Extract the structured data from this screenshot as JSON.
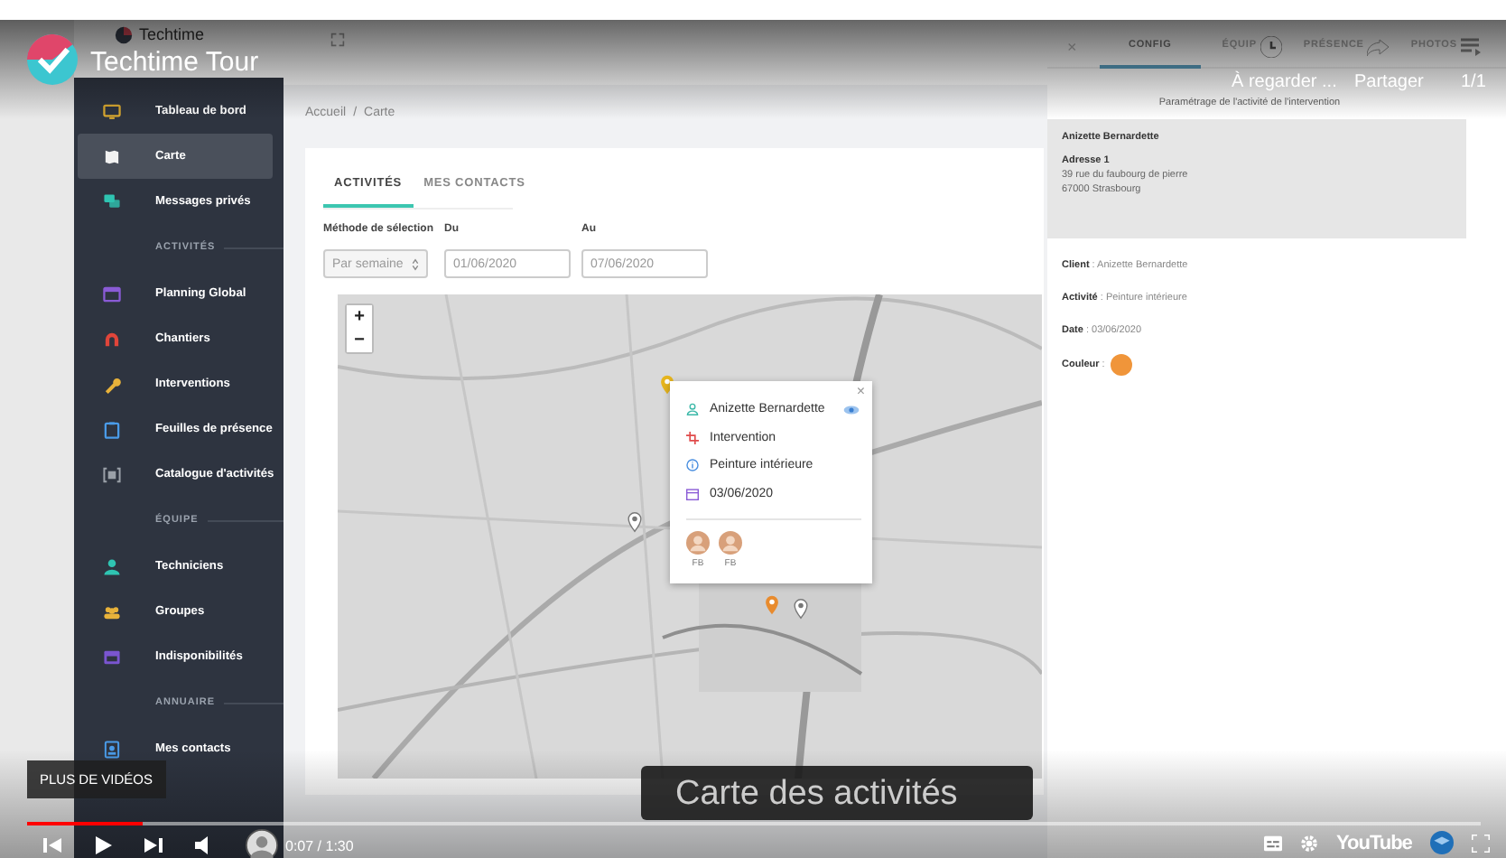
{
  "video": {
    "channel_title": "Techtime Tour",
    "watch_later": "À regarder ...",
    "share": "Partager",
    "playlist_position": "1/1",
    "more_videos": "PLUS DE VIDÉOS",
    "time": "0:07 / 1:30",
    "caption": "Carte des activités",
    "brand": "YouTube",
    "progress": {
      "level": 0.08
    }
  },
  "app": {
    "logo_text": "Techtime",
    "sidebar": [
      {
        "kind": "link",
        "label": "Tableau de bord",
        "selected": false,
        "color": "#d9a830"
      },
      {
        "kind": "link",
        "label": "Carte",
        "selected": true,
        "color": "#f2f2f2"
      },
      {
        "kind": "link",
        "label": "Messages privés",
        "selected": false,
        "color": "#2fc4b2"
      },
      {
        "kind": "section",
        "label": "ACTIVITÉS"
      },
      {
        "kind": "link",
        "label": "Planning Global",
        "selected": false,
        "color": "#8a5bd6"
      },
      {
        "kind": "link",
        "label": "Chantiers",
        "selected": false,
        "color": "#e0453a"
      },
      {
        "kind": "link",
        "label": "Interventions",
        "selected": false,
        "color": "#e8b23a"
      },
      {
        "kind": "link",
        "label": "Feuilles de présence",
        "selected": false,
        "color": "#4a9be8"
      },
      {
        "kind": "link",
        "label": "Catalogue d'activités",
        "selected": false,
        "color": "#9aa0a8"
      },
      {
        "kind": "section",
        "label": "ÉQUIPE"
      },
      {
        "kind": "link",
        "label": "Techniciens",
        "selected": false,
        "color": "#2fc4b2"
      },
      {
        "kind": "link",
        "label": "Groupes",
        "selected": false,
        "color": "#e8b23a"
      },
      {
        "kind": "link",
        "label": "Indisponibilités",
        "selected": false,
        "color": "#7a55d0"
      },
      {
        "kind": "section",
        "label": "ANNUAIRE"
      },
      {
        "kind": "link",
        "label": "Mes contacts",
        "selected": false,
        "color": "#4a9be8"
      }
    ],
    "breadcrumb": {
      "items": [
        "Accueil",
        "Carte"
      ],
      "separator": "/"
    },
    "tabs": [
      {
        "label": "ACTIVITÉS",
        "selected": true
      },
      {
        "label": "MES CONTACTS",
        "selected": false
      }
    ],
    "filters": {
      "method": {
        "label": "Méthode de sélection",
        "value": "Par semaine"
      },
      "from": {
        "label": "Du",
        "value": "01/06/2020"
      },
      "to": {
        "label": "Au",
        "value": "07/06/2020"
      }
    },
    "map": {
      "zoom_in": "+",
      "zoom_out": "−",
      "popup": {
        "close": "×",
        "name": "Anizette Bernardette",
        "type": "Intervention",
        "activity": "Peinture intérieure",
        "date": "03/06/2020",
        "avatars": [
          {
            "initials": "FB"
          },
          {
            "initials": "FB"
          }
        ]
      }
    },
    "details": {
      "close": "×",
      "tabs": [
        {
          "label": "CONFIG",
          "selected": true
        },
        {
          "label": "ÉQUIP",
          "selected": false
        },
        {
          "label": "PRÉSENCE",
          "selected": false
        },
        {
          "label": "PHOTOS",
          "selected": false
        }
      ],
      "subtitle": "Paramétrage de l'activité de l'intervention",
      "address_card": {
        "name": "Anizette Bernardette",
        "heading": "Adresse 1",
        "street": "39 rue du faubourg de pierre",
        "city": "67000 Strasbourg"
      },
      "fields": [
        {
          "kind": "text",
          "line": "**Client** : Anizette Bernardette"
        },
        {
          "kind": "text",
          "line": "**Activité** : Peinture intérieure"
        },
        {
          "kind": "text",
          "line": "**Date** : 03/06/2020"
        },
        {
          "kind": "color",
          "line": "**Couleur** :",
          "color": "#f0953a"
        }
      ]
    }
  }
}
